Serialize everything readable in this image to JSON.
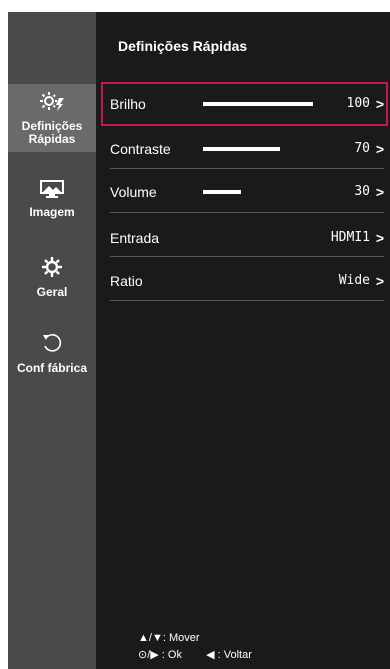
{
  "sidebar": {
    "items": [
      {
        "icon": "quick-settings-icon",
        "label": "Definições\nRápidas"
      },
      {
        "icon": "picture-icon",
        "label": "Imagem"
      },
      {
        "icon": "gear-icon",
        "label": "Geral"
      },
      {
        "icon": "reset-icon",
        "label": "Conf fábrica"
      }
    ]
  },
  "main": {
    "title": "Definições Rápidas",
    "rows": [
      {
        "label": "Brilho",
        "value": "100",
        "level": 100
      },
      {
        "label": "Contraste",
        "value": "70",
        "level": 70
      },
      {
        "label": "Volume",
        "value": "30",
        "level": 30
      },
      {
        "label": "Entrada",
        "value": "HDMI1"
      },
      {
        "label": "Ratio",
        "value": "Wide"
      }
    ]
  },
  "footer": {
    "move_symbols": "▲/▼:",
    "move": "Mover",
    "ok_symbols": "⊙/▶ :",
    "ok": "Ok",
    "back_symbols": "◀ :",
    "back": "Voltar"
  },
  "colors": {
    "accent": "#c2185b",
    "sidebar": "#4a4a4a",
    "active": "#6a6a6a",
    "background": "#1a1a1a"
  }
}
